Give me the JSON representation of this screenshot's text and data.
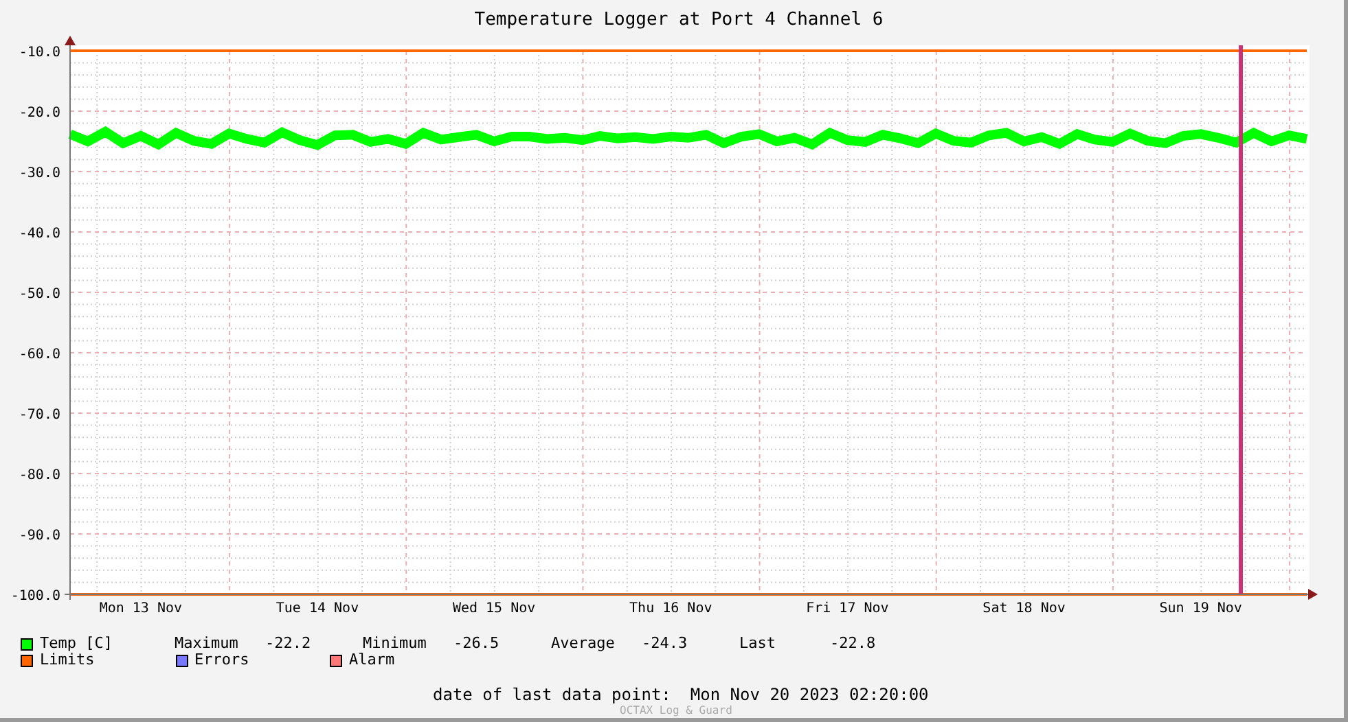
{
  "chart_data": {
    "type": "line",
    "title": "Temperature Logger at Port 4 Channel 6",
    "ylim": [
      -100,
      -10
    ],
    "grid": true,
    "categories": [
      null,
      null,
      null,
      null,
      "Mon 13 Nov",
      null,
      null,
      null,
      null,
      null,
      null,
      null,
      null,
      null,
      "Tue 14 Nov",
      null,
      null,
      null,
      null,
      null,
      null,
      null,
      null,
      null,
      "Wed 15 Nov",
      null,
      null,
      null,
      null,
      null,
      null,
      null,
      null,
      null,
      "Thu 16 Nov",
      null,
      null,
      null,
      null,
      null,
      null,
      null,
      null,
      null,
      "Fri 17 Nov",
      null,
      null,
      null,
      null,
      null,
      null,
      null,
      null,
      null,
      "Sat 18 Nov",
      null,
      null,
      null,
      null,
      null,
      null,
      null,
      null,
      null,
      "Sun 19 Nov",
      null,
      null,
      null,
      null,
      null,
      null
    ],
    "series": [
      {
        "name": "Temp [C]",
        "color": "#00ff00",
        "values": [
          -23.8,
          -25.0,
          -23.4,
          -25.3,
          -24.1,
          -25.5,
          -23.6,
          -24.9,
          -25.4,
          -23.7,
          -24.6,
          -25.2,
          -23.5,
          -24.8,
          -25.6,
          -24.0,
          -23.9,
          -25.1,
          -24.6,
          -25.4,
          -23.6,
          -24.7,
          -24.3,
          -23.9,
          -25.0,
          -24.2,
          -24.2,
          -24.6,
          -24.4,
          -24.8,
          -24.1,
          -24.5,
          -24.3,
          -24.6,
          -24.2,
          -24.4,
          -23.9,
          -25.3,
          -24.2,
          -23.8,
          -25.0,
          -24.4,
          -25.5,
          -23.6,
          -24.8,
          -25.1,
          -23.9,
          -24.5,
          -25.3,
          -23.7,
          -24.9,
          -25.2,
          -24.0,
          -23.6,
          -25.0,
          -24.3,
          -25.4,
          -23.8,
          -24.7,
          -25.1,
          -23.7,
          -24.9,
          -25.3,
          -24.1,
          -23.8,
          -24.4,
          -25.2,
          -23.6,
          -25.0,
          -24.0,
          -24.6
        ]
      },
      {
        "name": "Limits",
        "color": "#ff6600",
        "values": [
          -10,
          -10,
          -10,
          -10,
          -10,
          -10,
          -10,
          -10,
          -10,
          -10,
          -10,
          -10,
          -10,
          -10,
          -10,
          -10,
          -10,
          -10,
          -10,
          -10,
          -10,
          -10,
          -10,
          -10,
          -10,
          -10,
          -10,
          -10,
          -10,
          -10,
          -10,
          -10,
          -10,
          -10,
          -10,
          -10,
          -10,
          -10,
          -10,
          -10,
          -10,
          -10,
          -10,
          -10,
          -10,
          -10,
          -10,
          -10,
          -10,
          -10,
          -10,
          -10,
          -10,
          -10,
          -10,
          -10,
          -10,
          -10,
          -10,
          -10,
          -10,
          -10,
          -10,
          -10,
          -10,
          -10,
          -10,
          -10,
          -10,
          -10,
          -10
        ]
      }
    ],
    "yticks": [
      {
        "value": -10,
        "label": "-10.0"
      },
      {
        "value": -20,
        "label": "-20.0"
      },
      {
        "value": -30,
        "label": "-30.0"
      },
      {
        "value": -40,
        "label": "-40.0"
      },
      {
        "value": -50,
        "label": "-50.0"
      },
      {
        "value": -60,
        "label": "-60.0"
      },
      {
        "value": -70,
        "label": "-70.0"
      },
      {
        "value": -80,
        "label": "-80.0"
      },
      {
        "value": -90,
        "label": "-90.0"
      },
      {
        "value": -100,
        "label": "-100.0"
      }
    ],
    "ref_lines": [
      {
        "axis": "y",
        "value": -100,
        "color": "#ff6600"
      }
    ]
  },
  "legend": [
    {
      "stats": [
        {
          "label": "Maximum",
          "value": "-22.2"
        },
        {
          "label": "Minimum",
          "value": "-26.5"
        },
        {
          "label": "Average",
          "value": "-24.3"
        },
        {
          "label": "Last",
          "value": "-22.8"
        }
      ]
    },
    {
      "label": "Errors",
      "color": "#7777ff"
    },
    {
      "label": "Alarm",
      "color": "#ff7777"
    }
  ],
  "footer": {
    "label": "date of last data point:",
    "value": "Mon Nov 20 2023 02:20:00"
  },
  "watermark": "OCTAX Log & Guard"
}
